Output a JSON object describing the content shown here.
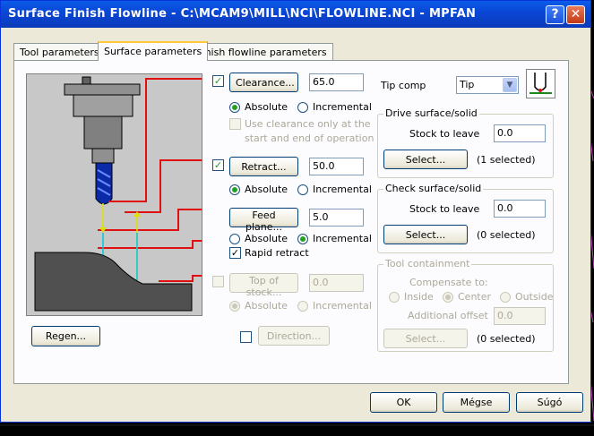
{
  "window": {
    "title": "Surface Finish Flowline - C:\\MCAM9\\MILL\\NCI\\FLOWLINE.NCI - MPFAN",
    "help_icon": "question-icon",
    "close_icon": "close-icon"
  },
  "tabs": [
    {
      "label": "Tool parameters",
      "active": false
    },
    {
      "label": "Surface parameters",
      "active": true
    },
    {
      "label": "Finish flowline parameters",
      "active": false
    }
  ],
  "clearance": {
    "checked": true,
    "button": "Clearance...",
    "value": "65.0",
    "absolute": "Absolute",
    "incremental": "Incremental",
    "mode": "absolute",
    "use_only_line1": "Use clearance only at the",
    "use_only_line2": "start and end of operation"
  },
  "retract": {
    "checked": true,
    "button": "Retract...",
    "value": "50.0",
    "absolute": "Absolute",
    "incremental": "Incremental",
    "mode": "absolute"
  },
  "feed_plane": {
    "button": "Feed plane...",
    "value": "5.0",
    "absolute": "Absolute",
    "incremental": "Incremental",
    "mode": "incremental",
    "rapid_retract_label": "Rapid retract",
    "rapid_retract_checked": true
  },
  "top_of_stock": {
    "checked": false,
    "button": "Top of stock...",
    "value": "0.0",
    "absolute": "Absolute",
    "incremental": "Incremental",
    "mode": "absolute"
  },
  "direction": {
    "checked": false,
    "button": "Direction..."
  },
  "tip_comp": {
    "label": "Tip comp",
    "selected": "Tip",
    "icon": "tool-tip-icon"
  },
  "drive_surface": {
    "title": "Drive surface/solid",
    "stock_label": "Stock to leave",
    "stock_value": "0.0",
    "select_button": "Select...",
    "selected_text": "(1  selected)"
  },
  "check_surface": {
    "title": "Check surface/solid",
    "stock_label": "Stock to leave",
    "stock_value": "0.0",
    "select_button": "Select...",
    "selected_text": "(0  selected)"
  },
  "tool_containment": {
    "title": "Tool containment",
    "compensate_label": "Compensate to:",
    "inside": "Inside",
    "center": "Center",
    "outside": "Outside",
    "mode": "center",
    "offset_label": "Additional offset",
    "offset_value": "0.0",
    "select_button": "Select...",
    "selected_text": "(0  selected)"
  },
  "regen_button": "Regen...",
  "footer": {
    "ok": "OK",
    "cancel": "Mégse",
    "help": "Súgó"
  },
  "colors": {
    "title_blue": "#0a47d6",
    "diagram_bg": "#c8c8c8",
    "height_line_red": "#e01010",
    "tool_blue": "#0a2aa8",
    "arrow_yellow": "#e0e000",
    "arrow_cyan": "#00c8e0"
  }
}
